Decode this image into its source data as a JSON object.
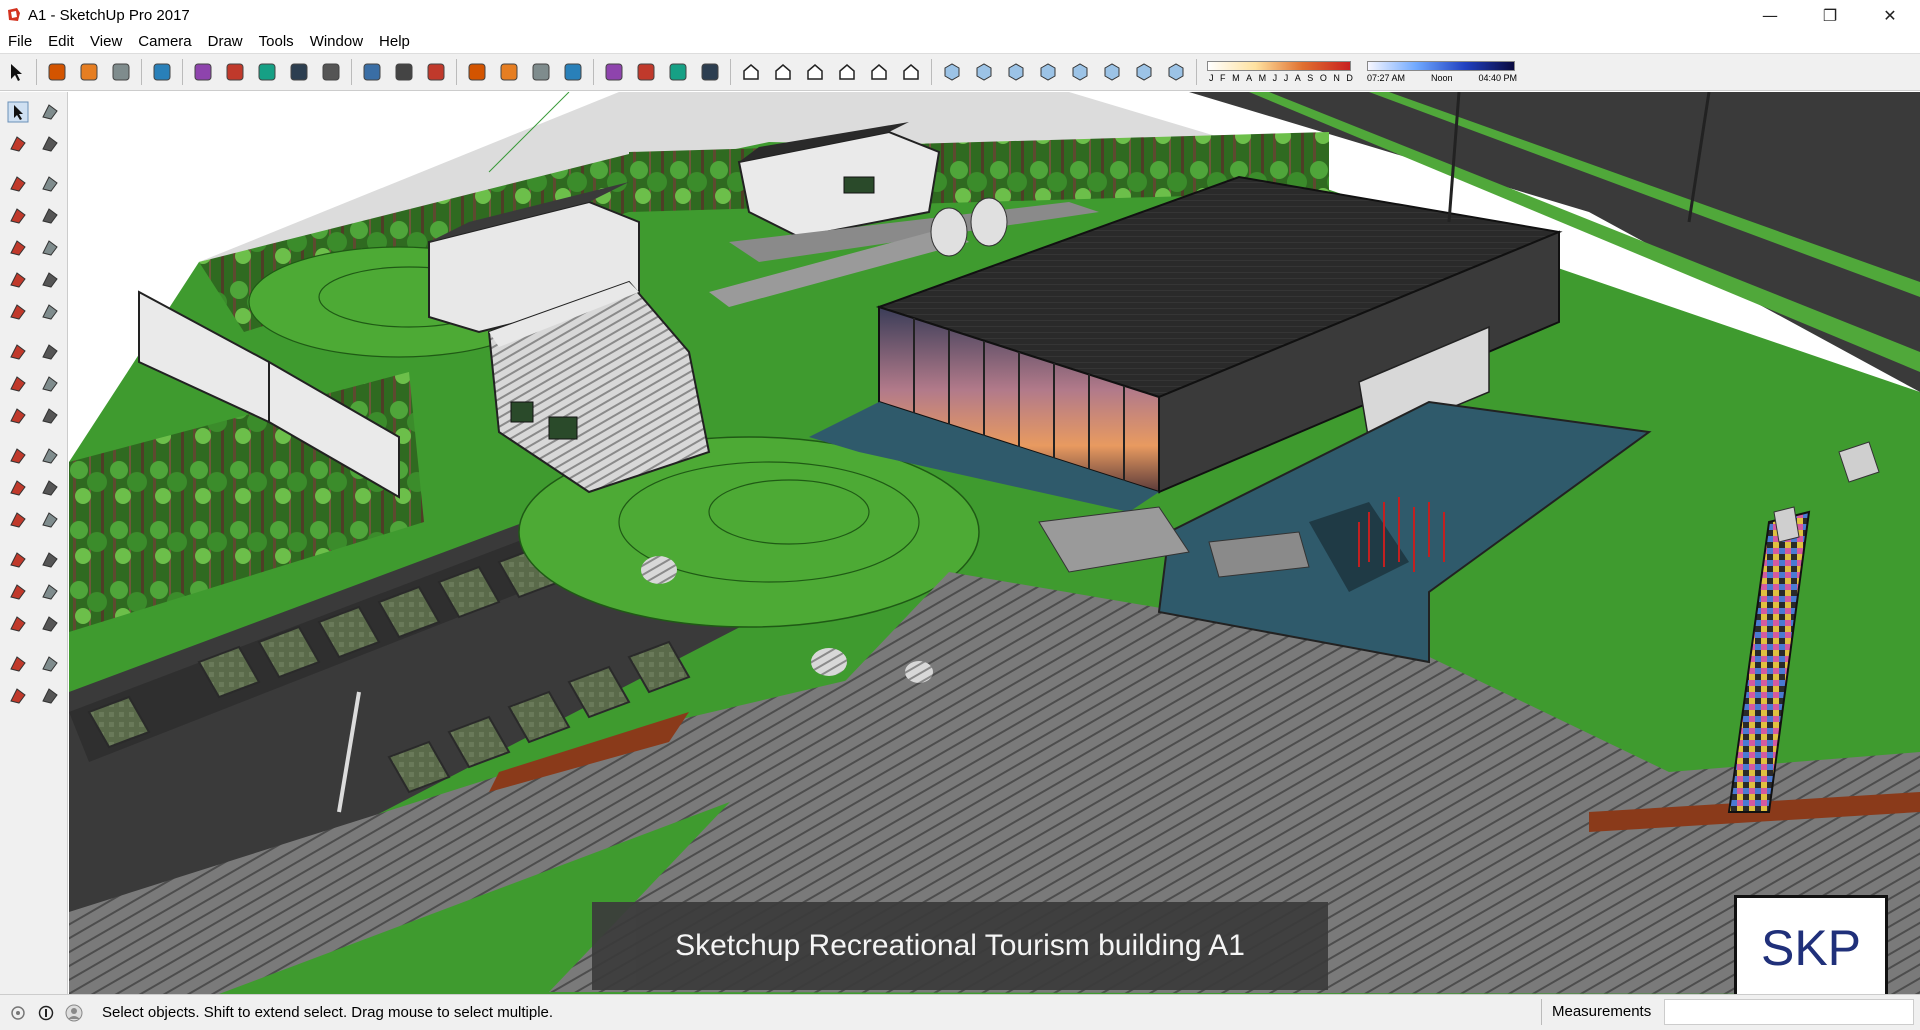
{
  "window": {
    "title": "A1 - SketchUp Pro 2017",
    "minimize_glyph": "—",
    "restore_glyph": "❐",
    "close_glyph": "✕"
  },
  "menu": {
    "items": [
      "File",
      "Edit",
      "View",
      "Camera",
      "Draw",
      "Tools",
      "Window",
      "Help"
    ]
  },
  "toolbar": {
    "icons": [
      "select-icon",
      "eraser-icon",
      "pencil-icon",
      "arc-icon",
      "circle-icon",
      "push-pull-icon",
      "follow-me-icon",
      "move-icon",
      "rotate-icon",
      "scale-icon",
      "tape-measure-icon",
      "text-icon",
      "paint-bucket-icon",
      "orbit-icon",
      "pan-icon",
      "zoom-icon",
      "zoom-extents-icon",
      "warehouse-icon",
      "extension-warehouse-icon",
      "share-model-icon",
      "ruby-icon",
      "iso-view-icon",
      "top-view-icon",
      "front-view-icon",
      "right-view-icon",
      "back-view-icon",
      "left-view-icon",
      "xray-icon",
      "back-edges-icon",
      "wireframe-icon",
      "hidden-line-icon",
      "shaded-icon",
      "shaded-textures-icon",
      "monochrome-icon",
      "shadows-icon"
    ],
    "shadow_months": [
      "J",
      "F",
      "M",
      "A",
      "M",
      "J",
      "J",
      "A",
      "S",
      "O",
      "N",
      "D"
    ],
    "shadow_time_start": "07:27 AM",
    "shadow_time_mid": "Noon",
    "shadow_time_end": "04:40 PM"
  },
  "left_toolbar": {
    "icons": [
      "select-icon",
      "make-component-icon",
      "paint-bucket-icon",
      "eraser-icon",
      "pencil-icon",
      "freehand-icon",
      "rectangle-icon",
      "rotated-rectangle-icon",
      "circle-icon",
      "polygon-icon",
      "arc-icon",
      "two-point-arc-icon",
      "three-point-arc-icon",
      "pie-icon",
      "move-icon",
      "push-pull-icon",
      "rotate-icon",
      "follow-me-icon",
      "scale-icon",
      "offset-icon",
      "tape-measure-icon",
      "dimension-icon",
      "protractor-icon",
      "text-icon",
      "axes-icon",
      "3d-text-icon",
      "orbit-icon",
      "pan-icon",
      "zoom-icon",
      "zoom-window-icon",
      "zoom-extents-icon",
      "previous-view-icon",
      "position-camera-icon",
      "look-around-icon",
      "walk-icon",
      "section-plane-icon"
    ]
  },
  "viewport": {
    "caption": "Sketchup Recreational Tourism building A1",
    "badge": "SKP"
  },
  "status": {
    "message": "Select objects. Shift to extend select. Drag mouse to select multiple.",
    "measurements_label": "Measurements",
    "measurements_value": ""
  },
  "colors": {
    "grass": "#3f9b2f",
    "grass_dark": "#2f7a22",
    "pavement": "#6e6e6e",
    "roof": "#2b2b2b",
    "water": "#2f5a6b",
    "sky": "#ffffff"
  }
}
